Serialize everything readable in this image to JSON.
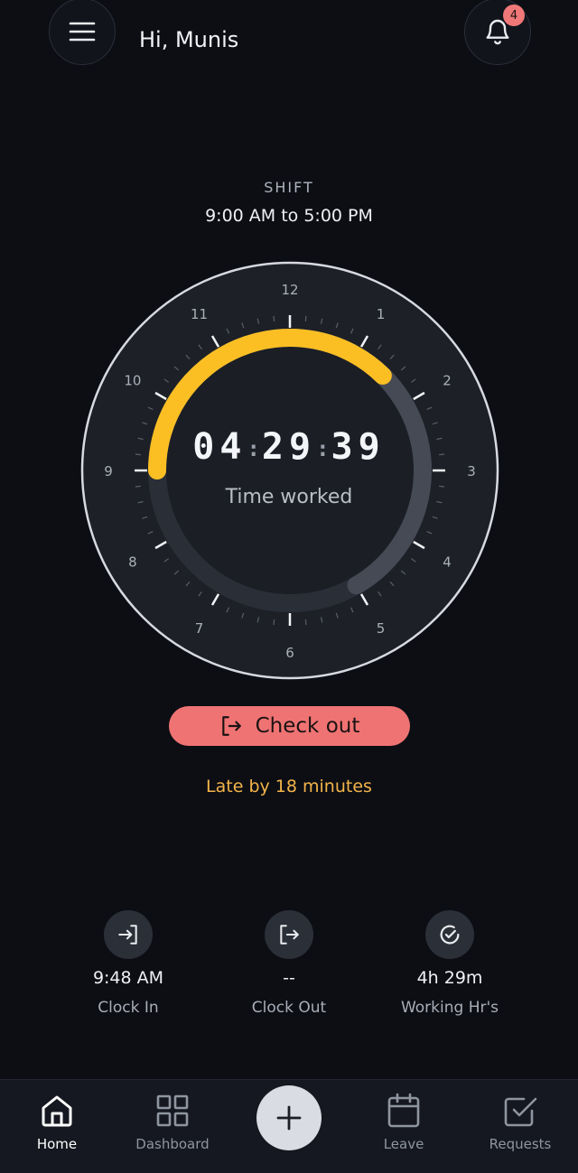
{
  "header": {
    "greeting": "Hi, Munis",
    "notification_count": "4"
  },
  "shift": {
    "label": "SHIFT",
    "time": "9:00 AM to 5:00 PM"
  },
  "timer": {
    "hours": "04",
    "minutes": "29",
    "seconds": "39",
    "label": "Time worked"
  },
  "clock": {
    "numbers": [
      "12",
      "1",
      "2",
      "3",
      "4",
      "5",
      "6",
      "7",
      "8",
      "9",
      "10",
      "11"
    ]
  },
  "progress": {
    "shift_fraction": 1.0,
    "worked_fraction": 0.56,
    "accent": "#fbbf24",
    "track": "#454a55"
  },
  "checkout": {
    "label": "Check out",
    "color": "#f07373"
  },
  "late_text": "Late by 18 minutes",
  "stats": [
    {
      "icon": "sign-in-icon",
      "value": "9:48 AM",
      "label": "Clock In"
    },
    {
      "icon": "sign-out-icon",
      "value": "--",
      "label": "Clock Out"
    },
    {
      "icon": "check-circle-icon",
      "value": "4h 29m",
      "label": "Working Hr's"
    }
  ],
  "nav": [
    {
      "icon": "home-icon",
      "label": "Home",
      "active": true
    },
    {
      "icon": "grid-icon",
      "label": "Dashboard"
    },
    {
      "icon": "calendar-icon",
      "label": "Leave"
    },
    {
      "icon": "check-square-icon",
      "label": "Requests"
    }
  ]
}
